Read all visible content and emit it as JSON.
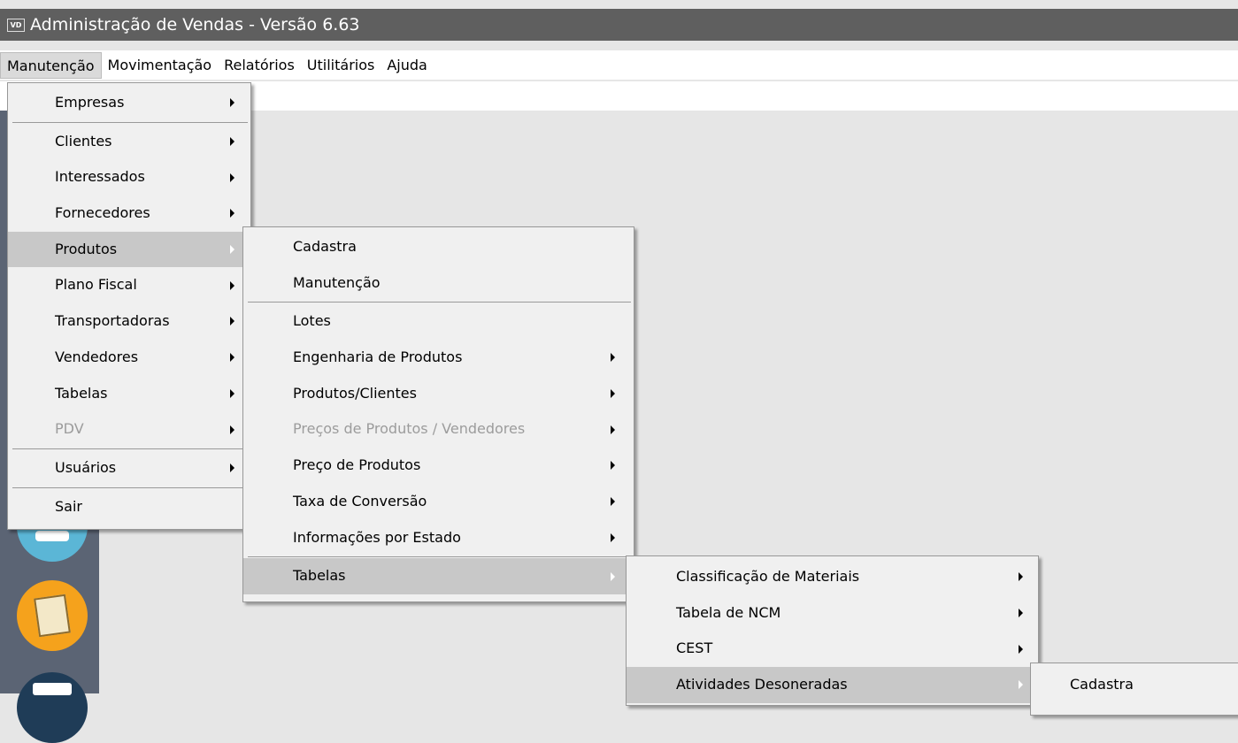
{
  "window": {
    "icon_text": "VD",
    "title": "Administração de Vendas - Versão 6.63"
  },
  "menubar": {
    "items": [
      "Manutenção",
      "Movimentação",
      "Relatórios",
      "Utilitários",
      "Ajuda"
    ]
  },
  "menu_manutencao": {
    "items": [
      "Empresas",
      "Clientes",
      "Interessados",
      "Fornecedores",
      "Produtos",
      "Plano Fiscal",
      "Transportadoras",
      "Vendedores",
      "Tabelas",
      "PDV",
      "Usuários",
      "Sair"
    ]
  },
  "menu_produtos": {
    "items": [
      "Cadastra",
      "Manutenção",
      "Lotes",
      "Engenharia de Produtos",
      "Produtos/Clientes",
      "Preços de Produtos / Vendedores",
      "Preço de Produtos",
      "Taxa de Conversão",
      "Informações por Estado",
      "Tabelas"
    ]
  },
  "menu_tabelas": {
    "items": [
      "Classificação de Materiais",
      "Tabela de NCM",
      "CEST",
      "Atividades Desoneradas"
    ]
  },
  "menu_atividades": {
    "items": [
      "Cadastra"
    ]
  },
  "colors": {
    "titlebar": "#5f5f5f",
    "menu_bg": "#f0f0f0",
    "highlight": "#c8c8c8",
    "toolbar": "#5b6474"
  }
}
